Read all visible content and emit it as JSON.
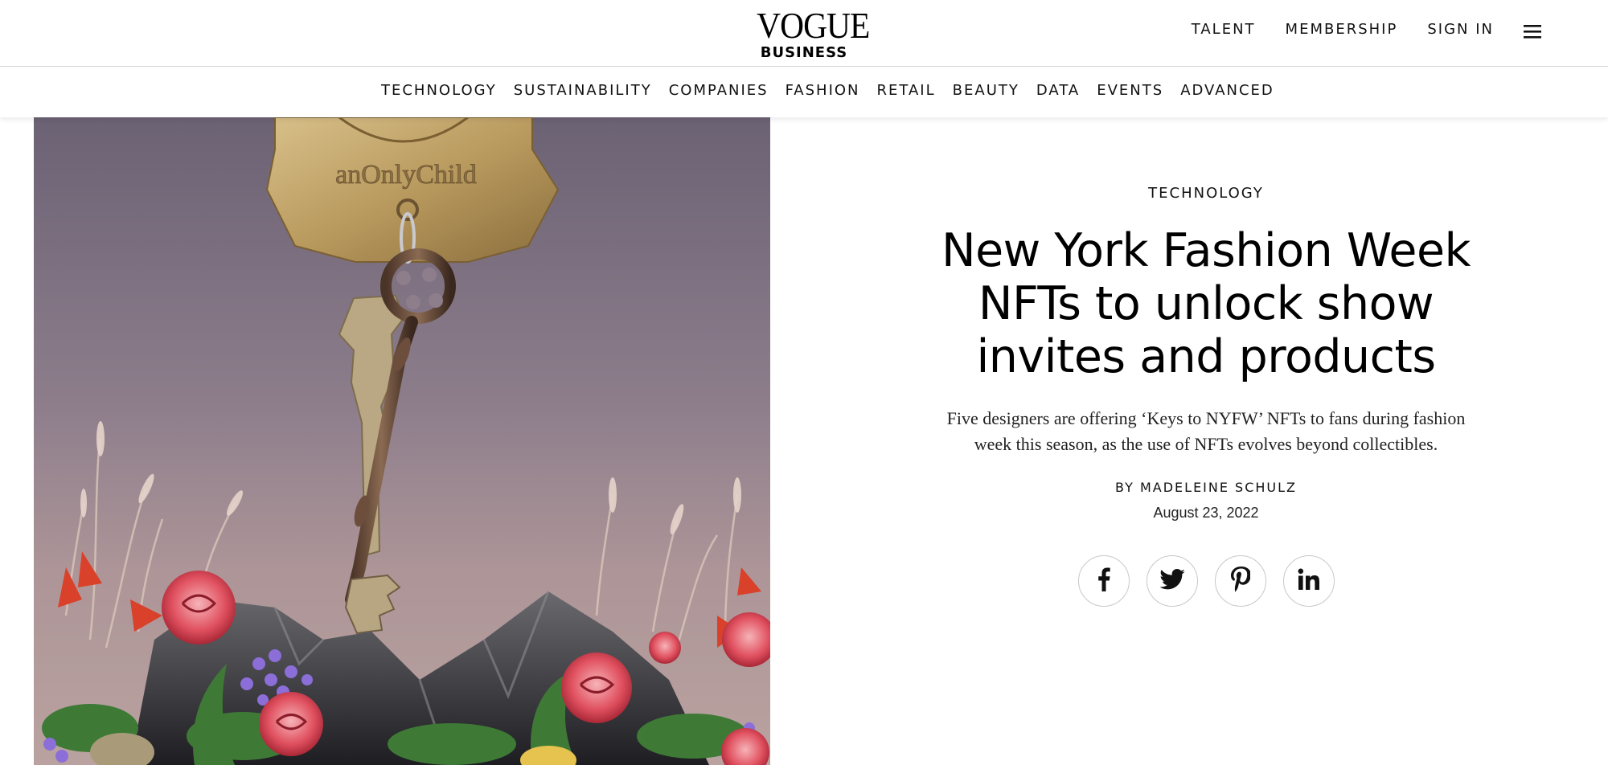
{
  "header": {
    "logo_main": "VOGUE",
    "logo_sub": "BUSINESS",
    "links": [
      "TALENT",
      "MEMBERSHIP",
      "SIGN IN"
    ],
    "menu_icon": "hamburger-menu-icon"
  },
  "section_nav": {
    "items": [
      "TECHNOLOGY",
      "SUSTAINABILITY",
      "COMPANIES",
      "FASHION",
      "RETAIL",
      "BEAUTY",
      "DATA",
      "EVENTS",
      "ADVANCED"
    ]
  },
  "hero": {
    "tag_text": "anOnlyChild"
  },
  "article": {
    "kicker": "TECHNOLOGY",
    "headline": "New York Fashion Week NFTs to unlock show invites and products",
    "dek": "Five designers are offering ‘Keys to NYFW’ NFTs to fans during fashion week this season, as the use of NFTs evolves beyond collectibles.",
    "byline_prefix": "BY",
    "author": "MADELEINE SCHULZ",
    "date": "August 23, 2022"
  },
  "share": {
    "icons": [
      "facebook-icon",
      "twitter-icon",
      "pinterest-icon",
      "linkedin-icon"
    ]
  }
}
